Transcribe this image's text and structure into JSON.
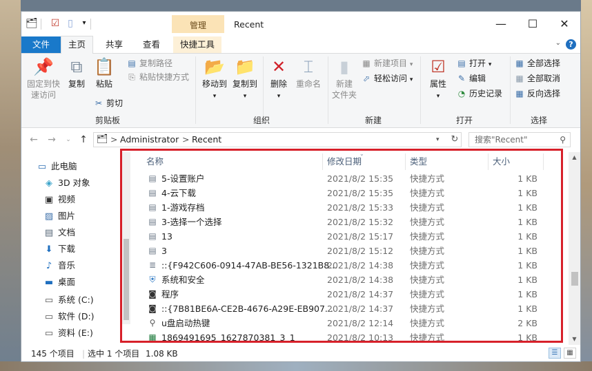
{
  "window": {
    "title": "Recent",
    "context_tab": "管理",
    "controls": {
      "minimize": "—",
      "maximize": "☐",
      "close": "✕"
    }
  },
  "tabs": [
    {
      "label": "文件"
    },
    {
      "label": "主页"
    },
    {
      "label": "共享"
    },
    {
      "label": "查看"
    },
    {
      "label": "快捷工具"
    }
  ],
  "ribbon": {
    "clipboard": {
      "label": "剪贴板",
      "pin": "固定到快\n速访问",
      "copy": "复制",
      "paste": "粘贴",
      "copy_path": "复制路径",
      "paste_shortcut": "粘贴快捷方式",
      "cut": "剪切"
    },
    "organize": {
      "label": "组织",
      "move_to": "移动到",
      "copy_to": "复制到",
      "delete": "删除",
      "rename": "重命名"
    },
    "new": {
      "label": "新建",
      "new_folder": "新建\n文件夹",
      "new_item": "新建项目",
      "easy_access": "轻松访问"
    },
    "open": {
      "label": "打开",
      "properties": "属性",
      "open": "打开",
      "edit": "编辑",
      "history": "历史记录"
    },
    "select": {
      "label": "选择",
      "select_all": "全部选择",
      "select_none": "全部取消",
      "invert": "反向选择"
    }
  },
  "address": {
    "parts": [
      "Administrator",
      "Recent"
    ],
    "separator": ">",
    "search_placeholder": "搜索\"Recent\""
  },
  "nav": [
    {
      "label": "此电脑",
      "icon": "computer-icon"
    },
    {
      "label": "3D 对象",
      "icon": "cube-icon"
    },
    {
      "label": "视频",
      "icon": "video-icon"
    },
    {
      "label": "图片",
      "icon": "picture-icon"
    },
    {
      "label": "文档",
      "icon": "document-icon"
    },
    {
      "label": "下载",
      "icon": "download-icon"
    },
    {
      "label": "音乐",
      "icon": "music-icon"
    },
    {
      "label": "桌面",
      "icon": "desktop-icon"
    },
    {
      "label": "系统 (C:)",
      "icon": "drive-icon"
    },
    {
      "label": "软件 (D:)",
      "icon": "drive-icon"
    },
    {
      "label": "资料 (E:)",
      "icon": "drive-icon"
    }
  ],
  "columns": {
    "name": "名称",
    "date": "修改日期",
    "type": "类型",
    "size": "大小"
  },
  "files": [
    {
      "name": "5-设置账户",
      "date": "2021/8/2 15:35",
      "type": "快捷方式",
      "size": "1 KB",
      "icon": "shortcut-icon"
    },
    {
      "name": "4-云下载",
      "date": "2021/8/2 15:35",
      "type": "快捷方式",
      "size": "1 KB",
      "icon": "shortcut-icon"
    },
    {
      "name": "1-游戏存档",
      "date": "2021/8/2 15:33",
      "type": "快捷方式",
      "size": "1 KB",
      "icon": "shortcut-icon"
    },
    {
      "name": "3-选择一个选择",
      "date": "2021/8/2 15:32",
      "type": "快捷方式",
      "size": "1 KB",
      "icon": "shortcut-icon"
    },
    {
      "name": "13",
      "date": "2021/8/2 15:17",
      "type": "快捷方式",
      "size": "1 KB",
      "icon": "shortcut-icon"
    },
    {
      "name": "3",
      "date": "2021/8/2 15:12",
      "type": "快捷方式",
      "size": "1 KB",
      "icon": "shortcut-icon"
    },
    {
      "name": "::{F942C606-0914-47AB-BE56-1321B8...",
      "date": "2021/8/2 14:38",
      "type": "快捷方式",
      "size": "1 KB",
      "icon": "database-icon"
    },
    {
      "name": "系统和安全",
      "date": "2021/8/2 14:38",
      "type": "快捷方式",
      "size": "1 KB",
      "icon": "security-icon"
    },
    {
      "name": "程序",
      "date": "2021/8/2 14:37",
      "type": "快捷方式",
      "size": "1 KB",
      "icon": "program-icon"
    },
    {
      "name": "::{7B81BE6A-CE2B-4676-A29E-EB907...",
      "date": "2021/8/2 14:37",
      "type": "快捷方式",
      "size": "1 KB",
      "icon": "program-icon"
    },
    {
      "name": "u盘启动热键",
      "date": "2021/8/2 12:14",
      "type": "快捷方式",
      "size": "2 KB",
      "icon": "search-icon"
    },
    {
      "name": "1869491695_1627870381_3_1",
      "date": "2021/8/2 10:13",
      "type": "快捷方式",
      "size": "1 KB",
      "icon": "spreadsheet-icon"
    }
  ],
  "status": {
    "count": "145 个项目",
    "selected": "选中 1 个项目",
    "size": "1.08 KB"
  },
  "colors": {
    "accent": "#1979ca",
    "highlight": "#d7202a",
    "manage_tab": "#fbe3b6"
  }
}
